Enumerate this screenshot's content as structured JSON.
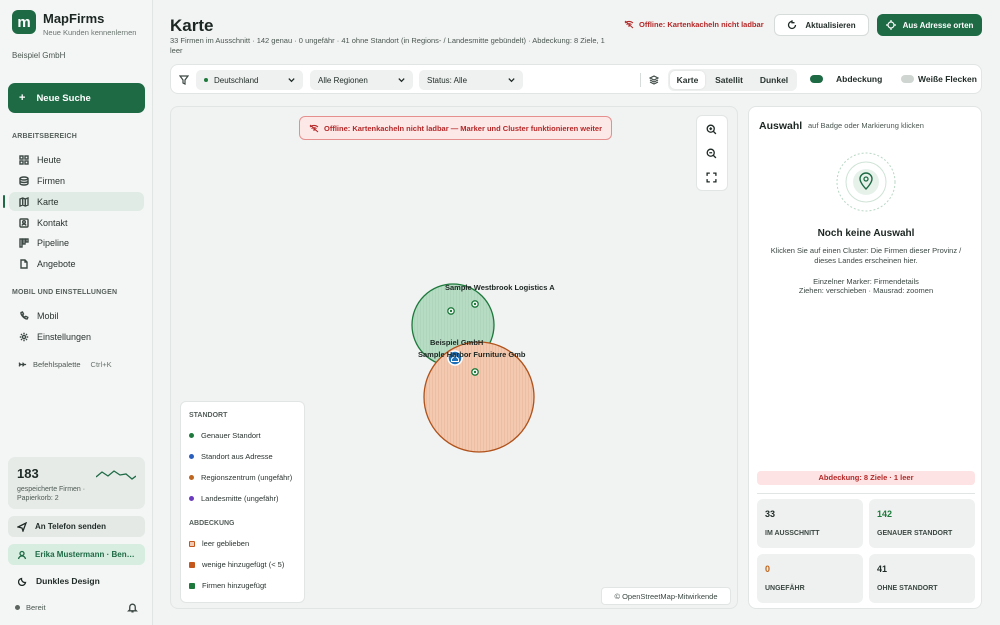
{
  "app": {
    "name": "MapFirms",
    "tagline": "Neue Kunden kennenlernen",
    "company": "Beispiel GmbH"
  },
  "sidebar": {
    "new_search": "Neue Suche",
    "section_work": "ARBEITSBEREICH",
    "items": [
      {
        "label": "Heute",
        "icon": "grid-icon"
      },
      {
        "label": "Firmen",
        "icon": "database-icon"
      },
      {
        "label": "Karte",
        "icon": "map-icon",
        "active": true
      },
      {
        "label": "Kontakt",
        "icon": "contact-icon"
      },
      {
        "label": "Pipeline",
        "icon": "pipeline-icon"
      },
      {
        "label": "Angebote",
        "icon": "document-icon"
      }
    ],
    "section_mobile": "MOBIL UND EINSTELLUNGEN",
    "items2": [
      {
        "label": "Mobil",
        "icon": "phone-icon"
      },
      {
        "label": "Einstellungen",
        "icon": "gear-icon"
      }
    ],
    "command_palette": "Befehlspalette",
    "command_shortcut": "Ctrl+K",
    "stats": {
      "count": "183",
      "text": "gespeicherte Firmen · Papierkorb: 2"
    },
    "phone_button": "An Telefon senden",
    "user": "Erika Mustermann · Ben…",
    "theme": "Dunkles Design",
    "status": "Bereit"
  },
  "header": {
    "title": "Karte",
    "subtitle": "33 Firmen im Ausschnitt · 142 genau · 0 ungefähr · 41 ohne Standort (in Regions- / Landesmitte gebündelt) · Abdeckung: 8 Ziele, 1 leer",
    "offline": "Offline: Kartenkacheln nicht ladbar",
    "refresh": "Aktualisieren",
    "locate": "Aus Adresse orten"
  },
  "filters": {
    "country": "Deutschland",
    "region": "Alle Regionen",
    "status": "Status: Alle",
    "layers": [
      "Karte",
      "Satellit",
      "Dunkel"
    ],
    "active_layer": "Karte",
    "coverage_label": "Abdeckung",
    "whitespots_label": "Weiße Flecken"
  },
  "map": {
    "offline_banner": "Offline: Kartenkacheln nicht ladbar — Marker und Cluster funktionieren weiter",
    "attribution": "© OpenStreetMap-Mitwirkende",
    "labels": {
      "westbrook": "Sample Westbrook Logistics A",
      "own": "Beispiel GmbH",
      "furniture": "Sample Harbor Furniture Gmb"
    },
    "legend": {
      "standort_title": "STANDORT",
      "standort": [
        {
          "label": "Genauer Standort",
          "color": "#1e7a3c"
        },
        {
          "label": "Standort aus Adresse",
          "color": "#2b5fbf"
        },
        {
          "label": "Regionszentrum (ungefähr)",
          "color": "#c0651e"
        },
        {
          "label": "Landesmitte (ungefähr)",
          "color": "#6b3bbf"
        }
      ],
      "abdeckung_title": "ABDECKUNG",
      "abdeckung": [
        {
          "label": "leer geblieben",
          "color": "#f1c9b3"
        },
        {
          "label": "wenige hinzugefügt (< 5)",
          "color": "#c4581c"
        },
        {
          "label": "Firmen hinzugefügt",
          "color": "#1e7a3c"
        }
      ]
    }
  },
  "panel": {
    "title": "Auswahl",
    "hint": "auf Badge oder Markierung klicken",
    "empty_title": "Noch keine Auswahl",
    "empty_text1": "Klicken Sie auf einen Cluster: Die Firmen dieser Provinz / dieses Landes erscheinen hier.",
    "empty_text2": "Einzelner Marker: Firmendetails",
    "empty_text3": "Ziehen: verschieben · Mausrad: zoomen",
    "coverage": "Abdeckung: 8 Ziele · 1 leer",
    "stats": [
      {
        "value": "33",
        "label": "IM AUSSCHNITT",
        "color": "#1f2a26"
      },
      {
        "value": "142",
        "label": "GENAUER STANDORT",
        "color": "#1e7a3c"
      },
      {
        "value": "0",
        "label": "UNGEFÄHR",
        "color": "#c0651e"
      },
      {
        "value": "41",
        "label": "OHNE STANDORT",
        "color": "#1f2a26"
      }
    ]
  }
}
